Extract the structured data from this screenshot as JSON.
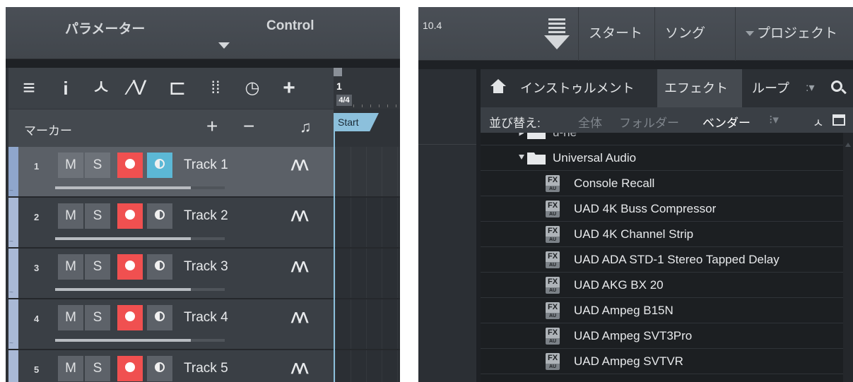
{
  "left": {
    "header": {
      "param": "パラメーター",
      "control": "Control"
    },
    "marker_bar": {
      "label": "マーカー",
      "plus": "+",
      "minus": "−",
      "note": "♫"
    },
    "ruler": {
      "bar": "1",
      "signature": "4/4",
      "position": "10.4",
      "marker": "Start"
    },
    "tracks": [
      {
        "num": "1",
        "m": "M",
        "s": "S",
        "name": "Track 1",
        "selected": true,
        "monitor": true,
        "fader": 0.8
      },
      {
        "num": "2",
        "m": "M",
        "s": "S",
        "name": "Track 2",
        "selected": false,
        "monitor": false,
        "fader": 0.8
      },
      {
        "num": "3",
        "m": "M",
        "s": "S",
        "name": "Track 3",
        "selected": false,
        "monitor": false,
        "fader": 0.8
      },
      {
        "num": "4",
        "m": "M",
        "s": "S",
        "name": "Track 4",
        "selected": false,
        "monitor": false,
        "fader": 0.8
      },
      {
        "num": "5",
        "m": "M",
        "s": "S",
        "name": "Track 5",
        "selected": false,
        "monitor": false,
        "fader": 0.8
      }
    ],
    "colors": {
      "record": "#f05050",
      "monitor_active": "#5cb8d6",
      "marker": "#8cc0dc"
    }
  },
  "right": {
    "header": {
      "start": "スタート",
      "song": "ソング",
      "project": "プロジェクト"
    },
    "browser": {
      "tabs": {
        "instruments": "インストゥルメント",
        "effects": "エフェクト",
        "loops": "ループ",
        "more": ":▾"
      },
      "sort": {
        "label": "並び替え:",
        "all": "全体",
        "folder": "フォルダー",
        "vendor": "ベンダー",
        "more": "⁝▾"
      },
      "partial_item": "u-he",
      "folder": "Universal Audio",
      "items": [
        "Console Recall",
        "UAD 4K Buss Compressor",
        "UAD 4K Channel Strip",
        "UAD ADA STD-1 Stereo Tapped Delay",
        "UAD AKG BX 20",
        "UAD Ampeg B15N",
        "UAD Ampeg SVT3Pro",
        "UAD Ampeg SVTVR"
      ],
      "fx_badge": "FX",
      "au_badge": "AU"
    }
  }
}
